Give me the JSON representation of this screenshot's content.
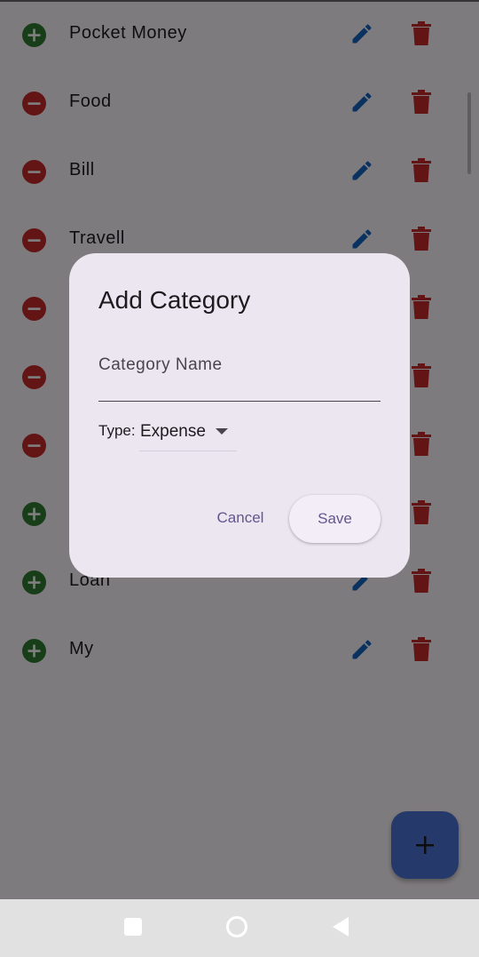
{
  "categories": [
    {
      "name": "Pocket Money",
      "type": "income"
    },
    {
      "name": "Food",
      "type": "expense"
    },
    {
      "name": "Bill",
      "type": "expense"
    },
    {
      "name": "Travell",
      "type": "expense"
    },
    {
      "name": "",
      "type": "expense"
    },
    {
      "name": "",
      "type": "expense"
    },
    {
      "name": "",
      "type": "expense"
    },
    {
      "name": "",
      "type": "income"
    },
    {
      "name": "Loan",
      "type": "income"
    },
    {
      "name": "My",
      "type": "income"
    }
  ],
  "icons": {
    "income": "add-circle-icon",
    "expense": "remove-circle-icon",
    "edit": "pencil-icon",
    "delete": "trash-icon",
    "fab": "plus-icon"
  },
  "colors": {
    "income": "#2e7d32",
    "expense": "#c62828",
    "edit": "#1565c0",
    "delete": "#c62828",
    "fab": "#4a72d6",
    "dialog_bg": "#ece6f0",
    "button_text": "#65558f"
  },
  "dialog": {
    "title": "Add Category",
    "name_placeholder": "Category Name",
    "name_value": "",
    "type_label": "Type:",
    "type_value": "Expense",
    "cancel_label": "Cancel",
    "save_label": "Save"
  },
  "navbar": {
    "recent": "recent-apps-icon",
    "home": "home-icon",
    "back": "back-icon"
  }
}
